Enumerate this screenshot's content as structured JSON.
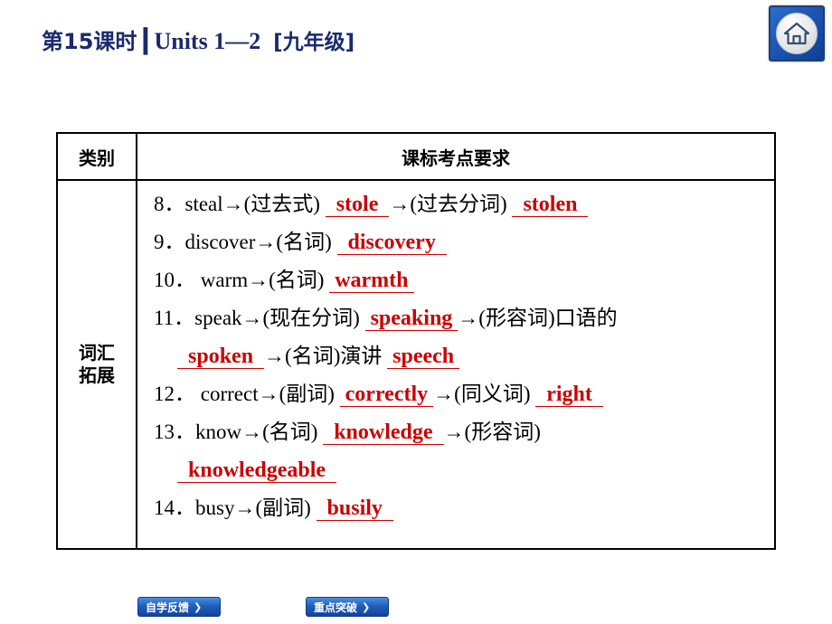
{
  "header": {
    "lesson": "第15课时",
    "separator": "┃",
    "units": "Units 1—2",
    "grade": "[九年级]",
    "home_icon": "home-icon"
  },
  "table": {
    "head": {
      "left": "类别",
      "right": "课标考点要求"
    },
    "row_label_line1": "词汇",
    "row_label_line2": "拓展",
    "items": [
      {
        "num": "8．",
        "seg1": "steal→(过去式) ",
        "ans1": "stole",
        "seg2": "→(过去分词) ",
        "ans2": "stolen"
      },
      {
        "num": "9．",
        "seg1": "discover→(名词) ",
        "ans1": "discovery"
      },
      {
        "num": "10．",
        "seg1": " warm→(名词) ",
        "ans1": "warmth"
      },
      {
        "num": "11．",
        "seg1": "speak→(现在分词) ",
        "ans1": "speaking",
        "seg2": "→(形容词)口语的"
      },
      {
        "ans1": "spoken",
        "seg2": "→(名词)演讲 ",
        "ans2": "speech"
      },
      {
        "num": "12．",
        "seg1": " correct→(副词) ",
        "ans1": "correctly",
        "seg2": "→(同义词) ",
        "ans2": "right"
      },
      {
        "num": "13．",
        "seg1": "know→(名词) ",
        "ans1": "knowledge",
        "seg2": "→(形容词)"
      },
      {
        "ans1": "knowledgeable"
      },
      {
        "num": "14．",
        "seg1": "busy→(副词) ",
        "ans1": "busily"
      }
    ]
  },
  "footer": {
    "self_study": "自学反馈",
    "key_points": "重点突破",
    "arrow": "❯"
  },
  "colors": {
    "answer_red": "#cc0000",
    "title_blue": "#1a2a6c",
    "button_blue": "#1f5fbb"
  }
}
